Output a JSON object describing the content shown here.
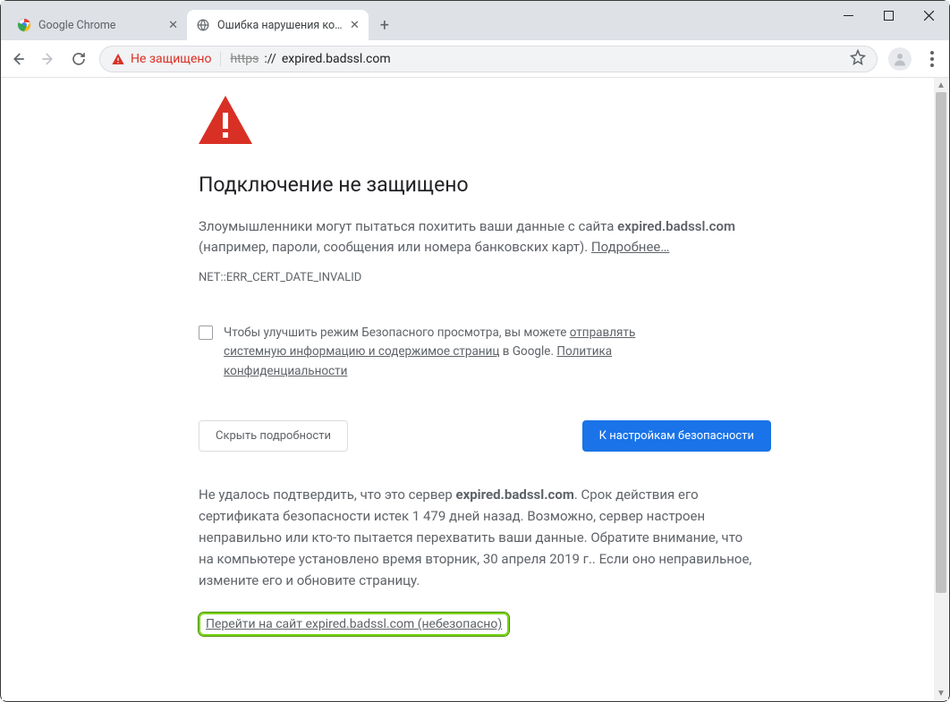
{
  "tabs": [
    {
      "title": "Google Chrome",
      "active": false
    },
    {
      "title": "Ошибка нарушения конфиденц",
      "active": true
    }
  ],
  "toolbar": {
    "security_label": "Не защищено",
    "url_scheme": "https",
    "url_sep": "://",
    "url_host": "expired.badssl.com"
  },
  "page": {
    "heading": "Подключение не защищено",
    "p1_a": "Злоумышленники могут пытаться похитить ваши данные с сайта ",
    "p1_b": "expired.badssl.com",
    "p1_c": " (например, пароли, сообщения или номера банковских карт). ",
    "p1_link": "Подробнее…",
    "err_code": "NET::ERR_CERT_DATE_INVALID",
    "opt_a": "Чтобы улучшить режим Безопасного просмотра, вы можете ",
    "opt_link1": "отправлять системную информацию и содержимое страниц",
    "opt_b": " в Google. ",
    "opt_link2": "Политика конфиденциальности",
    "hide_btn": "Скрыть подробности",
    "safety_btn": "К настройкам безопасности",
    "d_a": "Не удалось подтвердить, что это сервер ",
    "d_b": "expired.badssl.com",
    "d_c": ". Срок действия его сертификата безопасности истек 1 479 дней назад. Возможно, сервер настроен неправильно или кто-то пытается перехватить ваши данные. Обратите внимание, что на компьютере установлено время вторник, 30 апреля 2019 г.. Если оно неправильное, измените его и обновите страницу.",
    "proceed": "Перейти на сайт expired.badssl.com (небезопасно)"
  }
}
